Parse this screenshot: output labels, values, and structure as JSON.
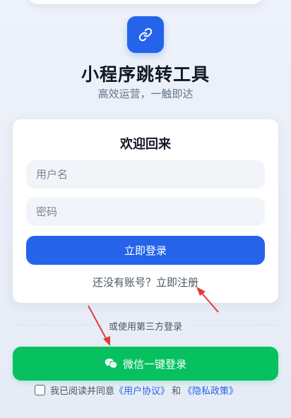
{
  "header": {
    "title": "小程序跳转工具",
    "subtitle": "高效运营，一触即达",
    "logo_icon": "link-icon"
  },
  "login_card": {
    "title": "欢迎回来",
    "username_placeholder": "用户名",
    "password_placeholder": "密码",
    "login_button": "立即登录",
    "register_prompt": "还没有账号？",
    "register_link": "立即注册"
  },
  "third_party": {
    "divider_text": "或使用第三方登录",
    "wechat_button": "微信一键登录",
    "wechat_icon": "wechat-icon"
  },
  "agreement": {
    "checked": false,
    "prefix": "我已阅读并同意",
    "user_agreement": "《用户协议》",
    "conjunction": "和",
    "privacy_policy": "《隐私政策》"
  },
  "colors": {
    "primary": "#2563eb",
    "wechat_green": "#07c160",
    "annotation_red": "#e53935"
  }
}
